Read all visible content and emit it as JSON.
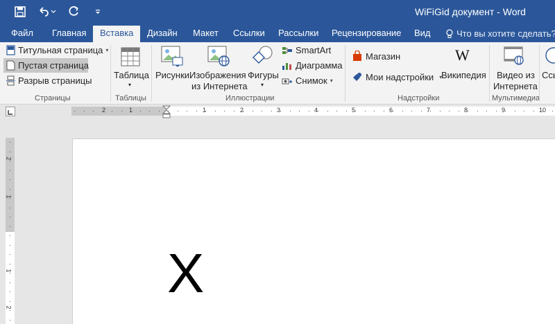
{
  "window": {
    "title": "WiFiGid документ - Word"
  },
  "tabs": [
    "Файл",
    "Главная",
    "Вставка",
    "Дизайн",
    "Макет",
    "Ссылки",
    "Рассылки",
    "Рецензирование",
    "Вид"
  ],
  "active_tab": "Вставка",
  "tell_me": "Что вы хотите сделать?",
  "ribbon": {
    "pages": {
      "cover": "Титульная страница",
      "blank": "Пустая страница",
      "break": "Разрыв страницы",
      "label": "Страницы"
    },
    "tables": {
      "table": "Таблица",
      "label": "Таблицы"
    },
    "illustrations": {
      "pictures": "Рисунки",
      "online_images_1": "Изображения",
      "online_images_2": "из Интернета",
      "shapes": "Фигуры",
      "smartart": "SmartArt",
      "chart": "Диаграмма",
      "screenshot": "Снимок",
      "label": "Иллюстрации"
    },
    "addins": {
      "store": "Магазин",
      "my_addins": "Мои надстройки",
      "wikipedia": "Википедия",
      "label": "Надстройки"
    },
    "media": {
      "video_1": "Видео из",
      "video_2": "Интернета",
      "label": "Мультимедиа"
    },
    "links_partial": "Ссы"
  },
  "ruler": {
    "h_labels": [
      "2",
      "1",
      "1",
      "2",
      "3",
      "4",
      "5",
      "6",
      "7",
      "8",
      "9",
      "10"
    ],
    "v_labels": [
      "2",
      "1",
      "1",
      "2"
    ]
  },
  "document": {
    "text": "X"
  },
  "colors": {
    "brand": "#2b579a",
    "ribbon": "#f3f3f3"
  }
}
